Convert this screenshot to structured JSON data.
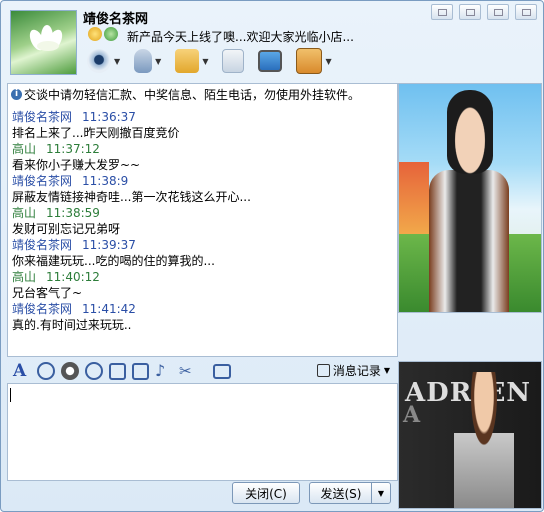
{
  "contact": {
    "name": "靖俊名茶网",
    "signature": "新产品今天上线了噢...欢迎大家光临小店..."
  },
  "header_icons": [
    "star-icon",
    "qq-status-icon"
  ],
  "toolbar": [
    {
      "name": "webcam-icon",
      "color": "#6a8fc1"
    },
    {
      "name": "microphone-icon",
      "color": "#7a99bf"
    },
    {
      "name": "send-file-icon",
      "color": "#e2a72c"
    },
    {
      "name": "create-group-icon",
      "color": "#3d9a4a"
    },
    {
      "name": "remote-desktop-icon",
      "color": "#2a6fbd"
    },
    {
      "name": "app-box-icon",
      "color": "#d98a2c"
    }
  ],
  "notice": "交谈中请勿轻信汇款、中奖信息、陌生电话，勿使用外挂软件。",
  "messages": [
    {
      "sender": "靖俊名茶网",
      "time": "11:36:37",
      "text": "排名上来了...昨天刚撤百度竞价",
      "me": false
    },
    {
      "sender": "高山",
      "time": "11:37:12",
      "text": "看来你小子赚大发罗~~",
      "me": true
    },
    {
      "sender": "靖俊名茶网",
      "time": "11:38:9",
      "text": "屏蔽友情链接神奇哇...第一次花钱这么开心...",
      "me": false
    },
    {
      "sender": "高山",
      "time": "11:38:59",
      "text": "发财可别忘记兄弟呀",
      "me": true
    },
    {
      "sender": "靖俊名茶网",
      "time": "11:39:37",
      "text": "你来福建玩玩...吃的喝的住的算我的...",
      "me": false
    },
    {
      "sender": "高山",
      "time": "11:40:12",
      "text": "兄台客气了~",
      "me": true
    },
    {
      "sender": "靖俊名茶网",
      "time": "11:41:42",
      "text": "真的.有时间过来玩玩..",
      "me": false
    }
  ],
  "format_icons": [
    "font-icon",
    "emoji-icon",
    "magic-face-icon",
    "vibrate-icon",
    "handwriting-icon",
    "screenshot-image-icon",
    "music-icon",
    "scissors-icon",
    "toolbox-icon"
  ],
  "history_label": "消息记录",
  "buttons": {
    "close": "关闭(C)",
    "send": "发送(S)"
  },
  "show_banner_text": "ADRIEN",
  "colors": {
    "sender_other": "#2a4ea6",
    "sender_me": "#2d7d3a",
    "border": "#7a9cc1"
  }
}
